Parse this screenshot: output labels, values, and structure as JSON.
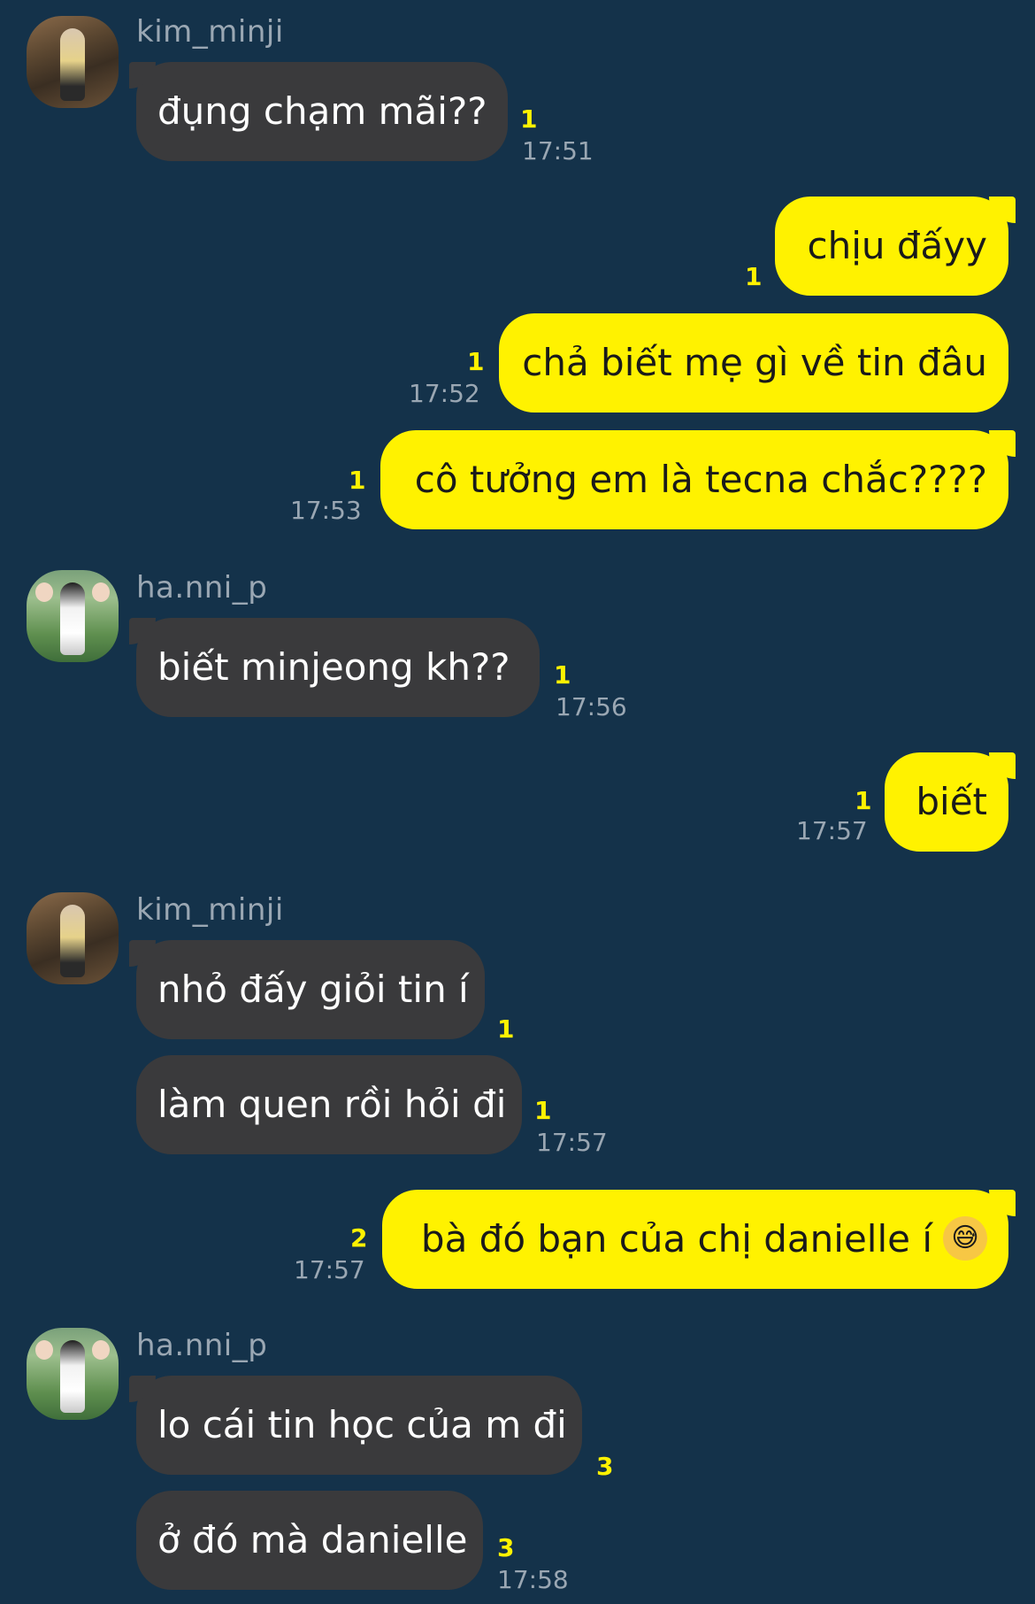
{
  "messages": {
    "m1": {
      "sender": "kim_minji",
      "text": "đụng chạm mãi??",
      "unread": "1",
      "time": "17:51"
    },
    "m2": {
      "text": "chịu đấyy",
      "unread": "1"
    },
    "m3": {
      "text": "chả biết mẹ gì về tin đâu",
      "unread": "1",
      "time": "17:52"
    },
    "m4": {
      "text": "cô tưởng em là tecna chắc????",
      "unread": "1",
      "time": "17:53"
    },
    "m5": {
      "sender": "ha.nni_p",
      "text": "biết minjeong kh??",
      "unread": "1",
      "time": "17:56"
    },
    "m6": {
      "text": "biết",
      "unread": "1",
      "time": "17:57"
    },
    "m7": {
      "sender": "kim_minji",
      "text": "nhỏ đấy giỏi tin í",
      "unread": "1"
    },
    "m8": {
      "text": "làm quen rồi hỏi đi",
      "unread": "1",
      "time": "17:57"
    },
    "m9": {
      "text": "bà đó bạn của chị danielle í",
      "emoji": "😅",
      "unread": "2",
      "time": "17:57"
    },
    "m10": {
      "sender": "ha.nni_p",
      "text": "lo cái tin học của m đi",
      "unread": "3"
    },
    "m11": {
      "text": "ở đó mà danielle",
      "unread": "3",
      "time": "17:58"
    }
  },
  "avatars": {
    "minji": "avatar-kim_minji",
    "hanni": "avatar-ha.nni_p"
  },
  "colors": {
    "background": "#14324a",
    "incoming_bubble": "#3a3a3c",
    "outgoing_bubble": "#fff200",
    "unread_count": "#fff200",
    "timestamp": "#9aa7b3"
  }
}
